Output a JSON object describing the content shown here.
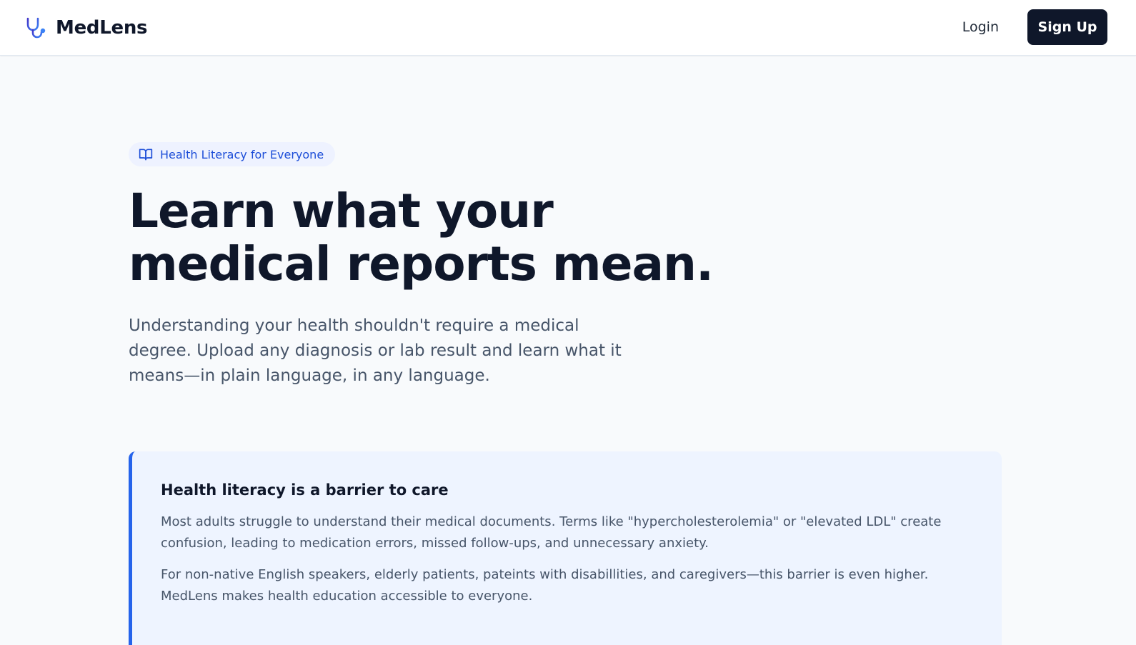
{
  "nav": {
    "brand_name": "MedLens",
    "brand_icon": "stethoscope-icon",
    "login_label": "Login",
    "signup_label": "Sign Up"
  },
  "hero": {
    "badge_icon": "book-open-icon",
    "badge_label": "Health Literacy for Everyone",
    "headline": "Learn what your medical reports mean.",
    "subtitle": "Understanding your health shouldn't require a medical degree. Upload any diagnosis or lab result and learn what it means—in plain language, in any language."
  },
  "callout": {
    "title": "Health literacy is a barrier to care",
    "paragraph_1": "Most adults struggle to understand their medical documents. Terms like \"hypercholesterolemia\" or \"elevated LDL\" create confusion, leading to medication errors, missed follow-ups, and unnecessary anxiety.",
    "paragraph_2": "For non-native English speakers, elderly patients, pateints with disabillities, and caregivers—this barrier is even higher. MedLens makes health education accessible to everyone."
  },
  "colors": {
    "primary_dark": "#0f172a",
    "accent_blue": "#2563eb",
    "badge_text": "#1d4ed8",
    "badge_bg": "#eef2ff",
    "callout_bg": "#eef4ff",
    "page_bg": "#f8fafc",
    "muted_text": "#475569",
    "logo_gradient_start": "#4f46e5",
    "logo_gradient_end": "#3b82f6"
  }
}
